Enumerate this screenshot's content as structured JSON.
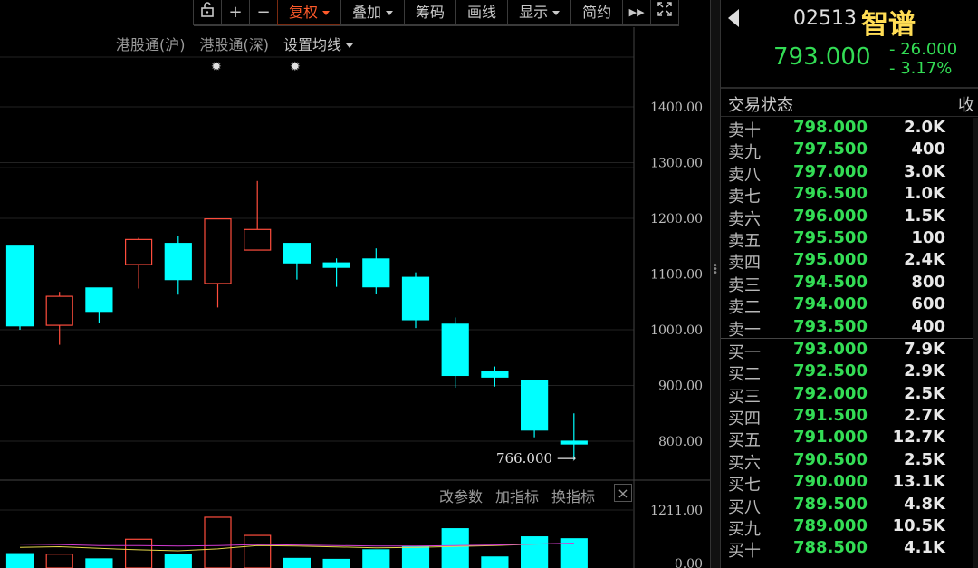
{
  "toolbar": {
    "buttons": [
      "复权",
      "叠加",
      "筹码",
      "画线",
      "显示",
      "简约"
    ],
    "lock_icon": "lock-icon",
    "zoom_in": "+",
    "zoom_out": "−",
    "forward": "▶▶",
    "fullscreen_icon": "expand-icon"
  },
  "subbar": {
    "sh_connect": "港股通(沪)",
    "sz_connect": "港股通(深)",
    "ma_setting": "设置均线"
  },
  "bottom_tools": {
    "edit_params": "改参数",
    "add_indicator": "加指标",
    "switch_indicator": "换指标",
    "close": "×"
  },
  "price_axis_labels": [
    "1400.00",
    "1300.00",
    "1200.00",
    "1100.00",
    "1000.00",
    "900.00",
    "800.00"
  ],
  "volume_axis_labels": [
    "1211.00",
    "0.00"
  ],
  "low_marker": "766.000",
  "colors": {
    "up": "#ff4d3d",
    "down": "#00ffff",
    "ma_yellow": "#e6d84a",
    "ma_purple": "#d23bd2"
  },
  "chart_data": {
    "type": "candlestick",
    "ylim": [
      750,
      1450
    ],
    "candles": [
      {
        "open": 1150,
        "close": 1007,
        "high": 1150,
        "low": 1000
      },
      {
        "open": 1008,
        "close": 1060,
        "high": 1068,
        "low": 973
      },
      {
        "open": 1075,
        "close": 1033,
        "high": 1075,
        "low": 1013
      },
      {
        "open": 1117,
        "close": 1162,
        "high": 1165,
        "low": 1074
      },
      {
        "open": 1155,
        "close": 1090,
        "high": 1168,
        "low": 1063
      },
      {
        "open": 1083,
        "close": 1199,
        "high": 1199,
        "low": 1040
      },
      {
        "open": 1143,
        "close": 1180,
        "high": 1267,
        "low": 1143
      },
      {
        "open": 1155,
        "close": 1120,
        "high": 1155,
        "low": 1090
      },
      {
        "open": 1120,
        "close": 1112,
        "high": 1128,
        "low": 1077
      },
      {
        "open": 1127,
        "close": 1077,
        "high": 1146,
        "low": 1064
      },
      {
        "open": 1094,
        "close": 1018,
        "high": 1103,
        "low": 1003
      },
      {
        "open": 1010,
        "close": 918,
        "high": 1022,
        "low": 896
      },
      {
        "open": 925,
        "close": 915,
        "high": 934,
        "low": 898
      },
      {
        "open": 908,
        "close": 820,
        "high": 908,
        "low": 807
      },
      {
        "open": 800,
        "close": 795,
        "high": 850,
        "low": 766
      }
    ],
    "volume_ylim": [
      0,
      1211
    ],
    "volumes": [
      300,
      290,
      190,
      600,
      290,
      1060,
      680,
      200,
      180,
      380,
      450,
      820,
      230,
      650,
      610
    ],
    "ma_lines": {
      "yellow": [
        430,
        445,
        410,
        380,
        360,
        400,
        470,
        460,
        440,
        420,
        430,
        450,
        470,
        500,
        510
      ],
      "purple": [
        500,
        490,
        470,
        470,
        460,
        470,
        490,
        480,
        470,
        460,
        460,
        470,
        480,
        500,
        520
      ]
    }
  },
  "quote": {
    "code": "02513",
    "name": "智谱",
    "price": "793.000",
    "change": "- 26.000",
    "change_pct": "- 3.17%",
    "status_label": "交易状态",
    "status_right": "收"
  },
  "asks": [
    {
      "label": "卖十",
      "price": "798.000",
      "vol": "2.0K"
    },
    {
      "label": "卖九",
      "price": "797.500",
      "vol": "400"
    },
    {
      "label": "卖八",
      "price": "797.000",
      "vol": "3.0K"
    },
    {
      "label": "卖七",
      "price": "796.500",
      "vol": "1.0K"
    },
    {
      "label": "卖六",
      "price": "796.000",
      "vol": "1.5K"
    },
    {
      "label": "卖五",
      "price": "795.500",
      "vol": "100"
    },
    {
      "label": "卖四",
      "price": "795.000",
      "vol": "2.4K"
    },
    {
      "label": "卖三",
      "price": "794.500",
      "vol": "800"
    },
    {
      "label": "卖二",
      "price": "794.000",
      "vol": "600"
    },
    {
      "label": "卖一",
      "price": "793.500",
      "vol": "400"
    }
  ],
  "bids": [
    {
      "label": "买一",
      "price": "793.000",
      "vol": "7.9K"
    },
    {
      "label": "买二",
      "price": "792.500",
      "vol": "2.9K"
    },
    {
      "label": "买三",
      "price": "792.000",
      "vol": "2.5K"
    },
    {
      "label": "买四",
      "price": "791.500",
      "vol": "2.7K"
    },
    {
      "label": "买五",
      "price": "791.000",
      "vol": "12.7K"
    },
    {
      "label": "买六",
      "price": "790.500",
      "vol": "2.5K"
    },
    {
      "label": "买七",
      "price": "790.000",
      "vol": "13.1K"
    },
    {
      "label": "买八",
      "price": "789.500",
      "vol": "4.8K"
    },
    {
      "label": "买九",
      "price": "789.000",
      "vol": "10.5K"
    },
    {
      "label": "买十",
      "price": "788.500",
      "vol": "4.1K"
    }
  ]
}
